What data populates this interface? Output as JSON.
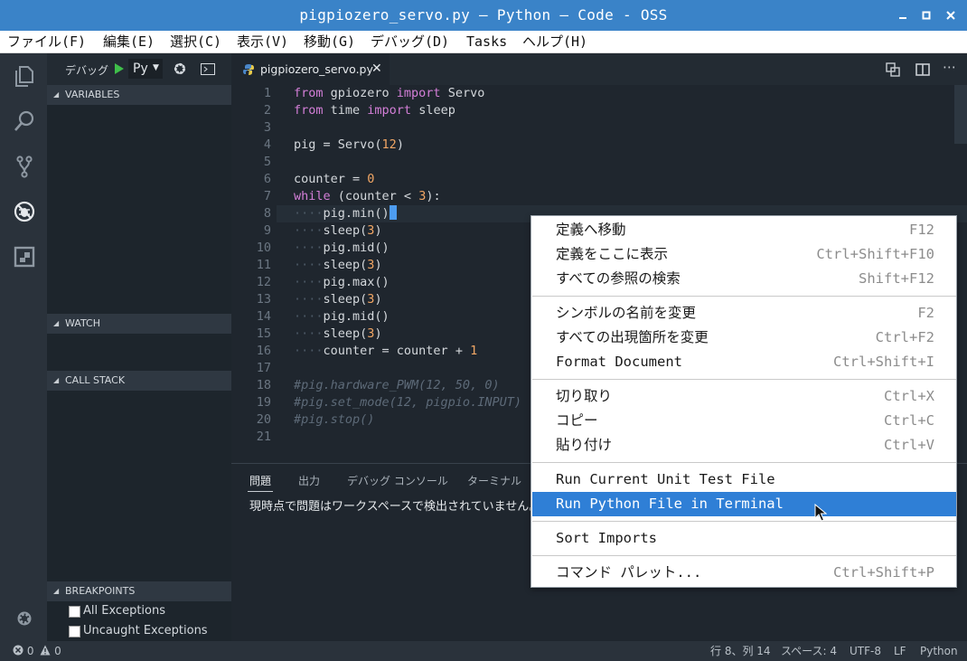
{
  "window": {
    "title": "pigpiozero_servo.py — Python — Code - OSS"
  },
  "menubar": [
    "ファイル(F)",
    "編集(E)",
    "選択(C)",
    "表示(V)",
    "移動(G)",
    "デバッグ(D)",
    "Tasks",
    "ヘルプ(H)"
  ],
  "debug": {
    "label": "デバッグ",
    "config": "Py"
  },
  "sidebar": {
    "variables": "VARIABLES",
    "watch": "WATCH",
    "callstack": "CALL STACK",
    "breakpoints": "BREAKPOINTS",
    "bp_items": [
      "All Exceptions",
      "Uncaught Exceptions"
    ]
  },
  "tab": {
    "filename": "pigpiozero_servo.py"
  },
  "code": {
    "line_numbers": [
      "1",
      "2",
      "3",
      "4",
      "5",
      "6",
      "7",
      "8",
      "9",
      "10",
      "11",
      "12",
      "13",
      "14",
      "15",
      "16",
      "17",
      "18",
      "19",
      "20",
      "21"
    ],
    "l1": {
      "a": "from",
      "b": " gpiozero ",
      "c": "import",
      "d": " Servo"
    },
    "l2": {
      "a": "from",
      "b": " time ",
      "c": "import",
      "d": " sleep"
    },
    "l4": {
      "a": "pig = Servo(",
      "b": "12",
      "c": ")"
    },
    "l6": {
      "a": "counter = ",
      "b": "0"
    },
    "l7": {
      "a": "while",
      "b": " (counter < ",
      "c": "3",
      "d": "):"
    },
    "l8": "pig.min()",
    "l9": {
      "a": "sleep(",
      "b": "3",
      "c": ")"
    },
    "l10": "pig.mid()",
    "l11": {
      "a": "sleep(",
      "b": "3",
      "c": ")"
    },
    "l12": "pig.max()",
    "l13": {
      "a": "sleep(",
      "b": "3",
      "c": ")"
    },
    "l14": "pig.mid()",
    "l15": {
      "a": "sleep(",
      "b": "3",
      "c": ")"
    },
    "l16": {
      "a": "counter = counter + ",
      "b": "1"
    },
    "l18": "#pig.hardware_PWM(12, 50, 0)",
    "l19": "#pig.set_mode(12, pigpio.INPUT)",
    "l20": "#pig.stop()"
  },
  "panel": {
    "tabs": [
      "問題",
      "出力",
      "デバッグ コンソール",
      "ターミナル"
    ],
    "message": "現時点で問題はワークスペースで検出されていません。"
  },
  "context_menu": [
    {
      "label": "定義へ移動",
      "key": "F12"
    },
    {
      "label": "定義をここに表示",
      "key": "Ctrl+Shift+F10"
    },
    {
      "label": "すべての参照の検索",
      "key": "Shift+F12"
    },
    {
      "label": "シンボルの名前を変更",
      "key": "F2"
    },
    {
      "label": "すべての出現箇所を変更",
      "key": "Ctrl+F2"
    },
    {
      "label": "Format Document",
      "key": "Ctrl+Shift+I"
    },
    {
      "label": "切り取り",
      "key": "Ctrl+X"
    },
    {
      "label": "コピー",
      "key": "Ctrl+C"
    },
    {
      "label": "貼り付け",
      "key": "Ctrl+V"
    },
    {
      "label": "Run Current Unit Test File",
      "key": ""
    },
    {
      "label": "Run Python File in Terminal",
      "key": ""
    },
    {
      "label": "Sort Imports",
      "key": ""
    },
    {
      "label": "コマンド パレット...",
      "key": "Ctrl+Shift+P"
    }
  ],
  "status": {
    "errors": "0",
    "warnings": "0",
    "position": "行 8、列 14",
    "spaces": "スペース: 4",
    "encoding": "UTF-8",
    "eol": "LF",
    "language": "Python"
  },
  "colors": {
    "titlebar": "#3a83c8",
    "highlight": "#2f7fd6",
    "keyword": "#d47fd8",
    "number": "#f2a765"
  }
}
